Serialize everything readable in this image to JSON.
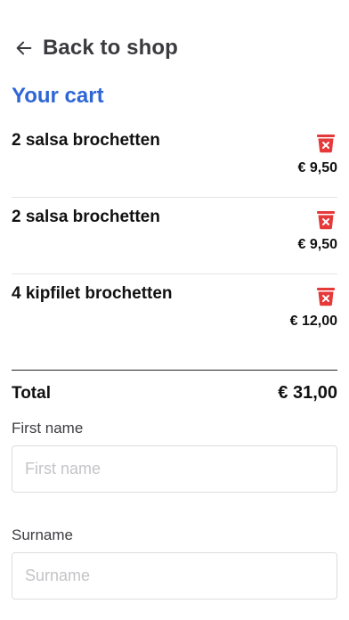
{
  "nav": {
    "back_label": "Back to shop",
    "back_icon": "arrow-left-icon"
  },
  "cart": {
    "title": "Your cart",
    "items": [
      {
        "name": "2 salsa brochetten",
        "price": "€ 9,50"
      },
      {
        "name": "2 salsa brochetten",
        "price": "€ 9,50"
      },
      {
        "name": "4 kipfilet brochetten",
        "price": "€ 12,00"
      }
    ],
    "total_label": "Total",
    "total_value": "€ 31,00"
  },
  "form": {
    "first_name": {
      "label": "First name",
      "placeholder": "First name",
      "value": ""
    },
    "surname": {
      "label": "Surname",
      "placeholder": "Surname",
      "value": ""
    }
  },
  "colors": {
    "accent": "#2f66d6",
    "delete": "#e5393a",
    "text": "#111111"
  },
  "icons": {
    "delete": "trash-icon"
  }
}
